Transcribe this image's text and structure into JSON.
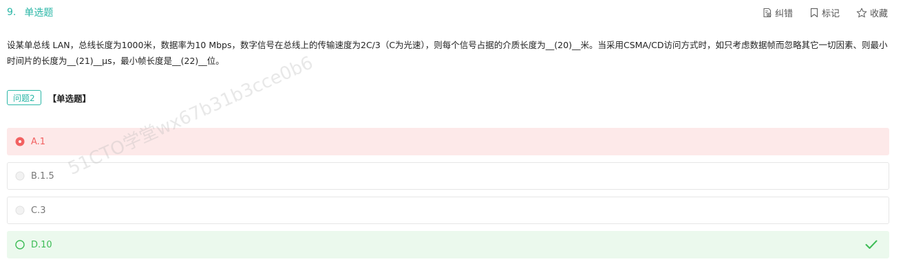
{
  "question": {
    "number": "9.",
    "type_title": "单选题",
    "stem": "设某单总线 LAN，总线长度为1000米，数据率为10 Mbps，数字信号在总线上的传输速度为2C/3（C为光速），则每个信号占据的介质长度为__(20)__米。当采用CSMA/CD访问方式时，如只考虑数据帧而忽略其它一切因素、则最小时间片的长度为__(21)__μs，最小帧长度是__(22)__位。",
    "sub_tag": "问题2",
    "sub_type": "【单选题】"
  },
  "actions": {
    "report": "纠错",
    "mark": "标记",
    "favorite": "收藏"
  },
  "options": [
    {
      "label": "A.1",
      "state": "wrong-selected"
    },
    {
      "label": "B.1.5",
      "state": "normal"
    },
    {
      "label": "C.3",
      "state": "normal"
    },
    {
      "label": "D.10",
      "state": "correct"
    }
  ],
  "watermark": "51CTO学堂wx67b31b3cce0b6",
  "colors": {
    "accent": "#29b6a6",
    "wrong": "#f26161",
    "wrong_bg": "#fde9e9",
    "correct": "#3cbc55",
    "correct_bg": "#ebf9ed"
  },
  "icons": {
    "report": "report-error-icon",
    "mark": "bookmark-icon",
    "favorite": "star-icon",
    "check": "check-icon"
  }
}
